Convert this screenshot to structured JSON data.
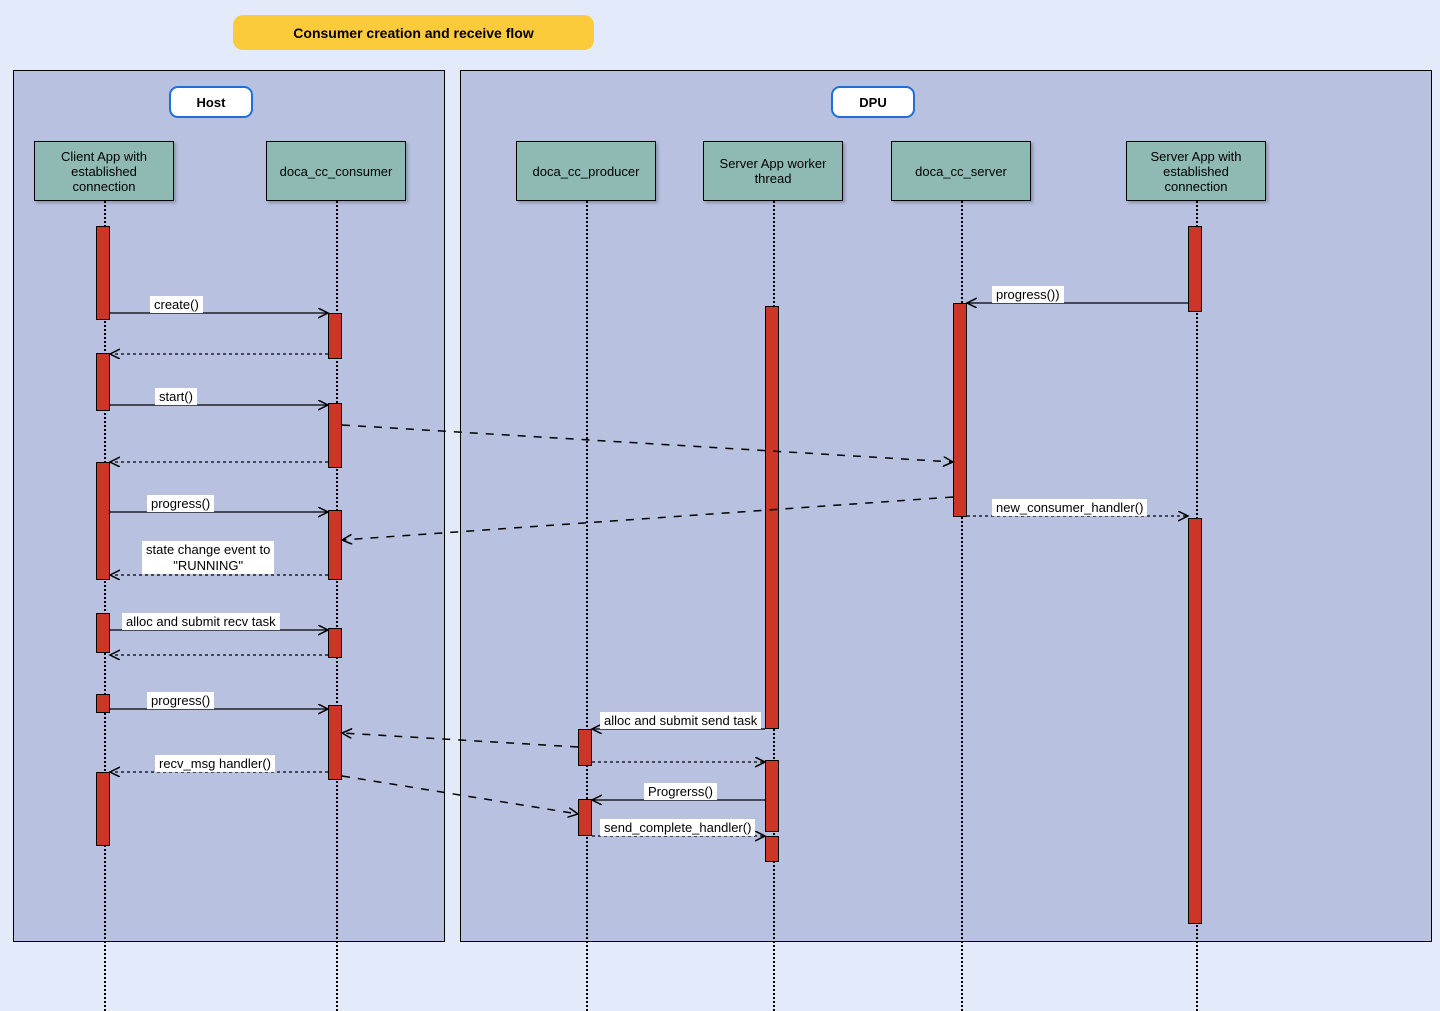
{
  "title": "Consumer creation and receive flow",
  "groups": {
    "host": "Host",
    "dpu": "DPU"
  },
  "participants": {
    "client": "Client App with established connection",
    "consumer": "doca_cc_consumer",
    "producer": "doca_cc_producer",
    "worker": "Server App worker thread",
    "server": "doca_cc_server",
    "serverApp": "Server App with established connection"
  },
  "messages": {
    "create": "create()",
    "start": "start()",
    "progress_client": "progress()",
    "state_change": "state change event to \"RUNNING\"",
    "alloc_recv": "alloc and submit recv task",
    "progress_client2": "progress()",
    "recv_handler": "recv_msg handler()",
    "progress_server": "progress())",
    "new_consumer": "new_consumer_handler()",
    "alloc_send": "alloc and submit send task",
    "progress_worker": "Progrerss()",
    "send_complete": "send_complete_handler()"
  }
}
